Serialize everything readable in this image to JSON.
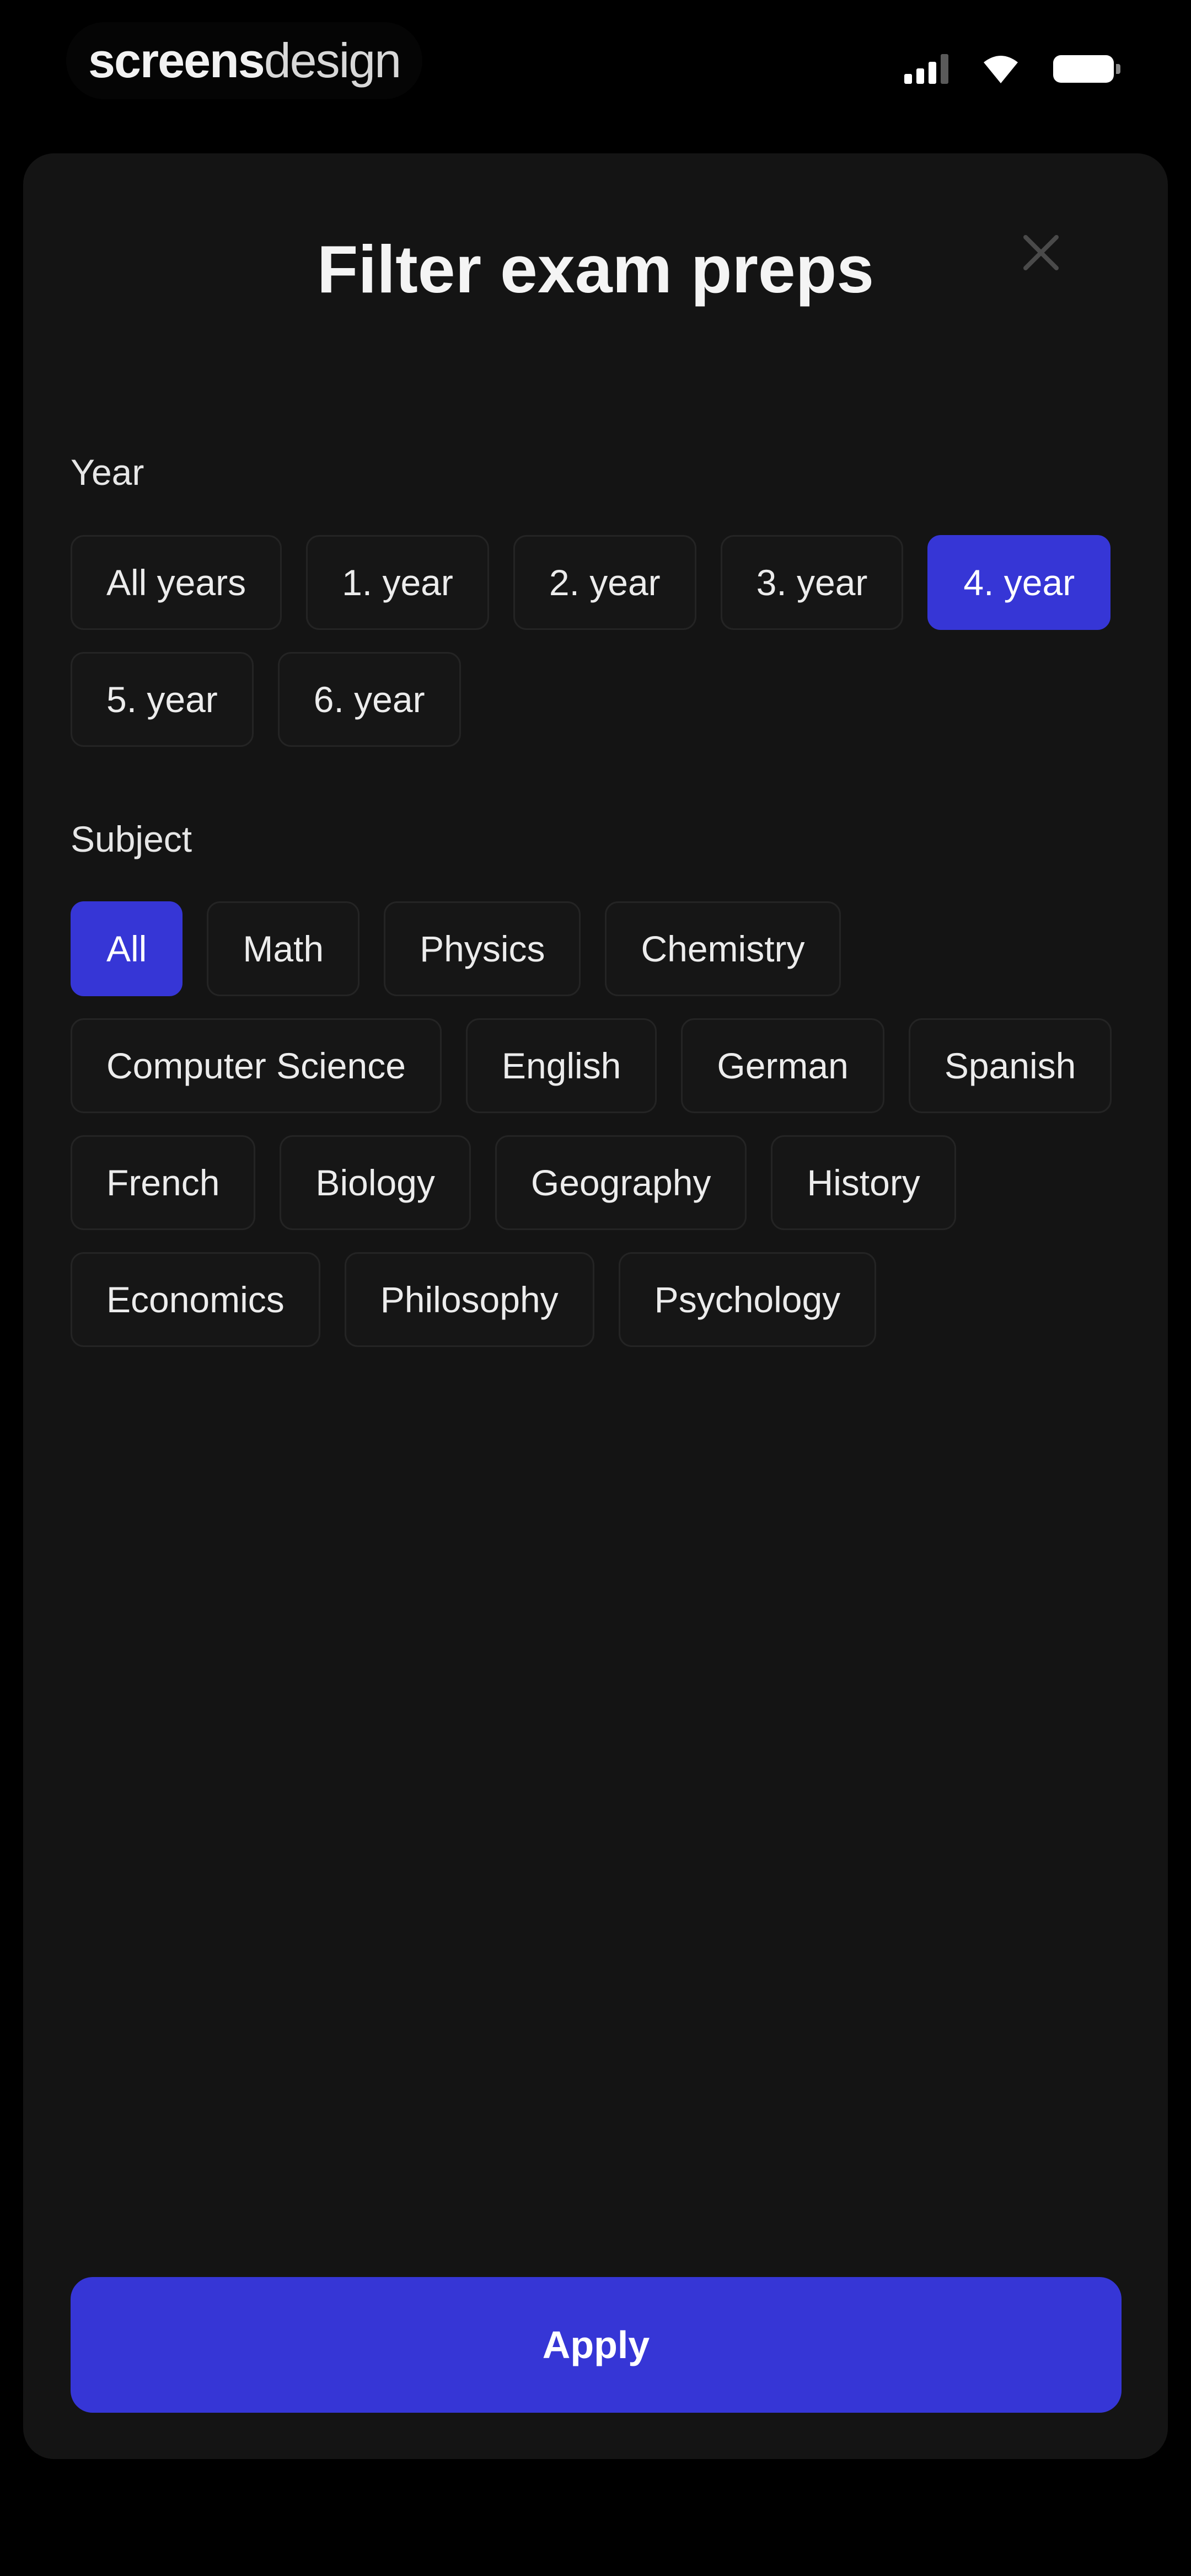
{
  "status_bar": {
    "brand_bold": "screens",
    "brand_light": "design"
  },
  "sheet": {
    "title": "Filter exam preps",
    "close_icon": "close-icon"
  },
  "year": {
    "label": "Year",
    "options": [
      "All years",
      "1. year",
      "2. year",
      "3. year",
      "4. year",
      "5. year",
      "6. year"
    ],
    "selected": "4. year"
  },
  "subject": {
    "label": "Subject",
    "options": [
      "All",
      "Math",
      "Physics",
      "Chemistry",
      "Computer Science",
      "English",
      "German",
      "Spanish",
      "French",
      "Biology",
      "Geography",
      "History",
      "Economics",
      "Philosophy",
      "Psychology"
    ],
    "selected": "All"
  },
  "apply_label": "Apply",
  "colors": {
    "accent": "#3636d6",
    "sheet_background": "#141414",
    "chip_border": "#242424"
  }
}
